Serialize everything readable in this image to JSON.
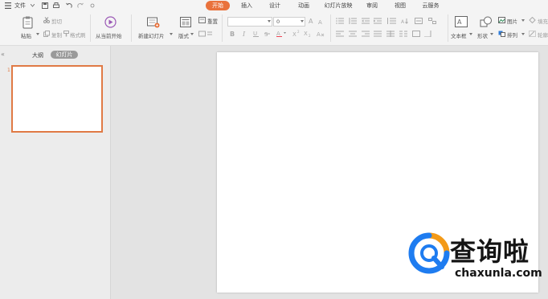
{
  "menubar": {
    "file_label": "文件",
    "tabs": [
      {
        "label": "开始",
        "active": true
      },
      {
        "label": "插入"
      },
      {
        "label": "设计"
      },
      {
        "label": "动画"
      },
      {
        "label": "幻灯片放映"
      },
      {
        "label": "审阅"
      },
      {
        "label": "视图"
      },
      {
        "label": "云服务"
      }
    ]
  },
  "ribbon": {
    "paste": "粘贴",
    "cut": "剪切",
    "copy": "复制",
    "format_painter": "格式刷",
    "play_from_current": "从当前开始",
    "new_slide": "新建幻灯片",
    "layout": "版式",
    "reset": "重置",
    "font_size_value": "0",
    "textbox": "文本框",
    "shape": "形状",
    "picture": "图片",
    "arrange": "排列",
    "fill": "填充",
    "outline": "轮廓"
  },
  "left_panel": {
    "tab_outline": "大纲",
    "tab_slides": "幻灯片",
    "slide_number": "1",
    "collapse_glyph": "«"
  },
  "watermark": {
    "title": "查询啦",
    "url": "chaxunla.com"
  },
  "colors": {
    "accent": "#e9723c",
    "logo_blue": "#1e7cf0",
    "logo_orange": "#f39a18"
  }
}
